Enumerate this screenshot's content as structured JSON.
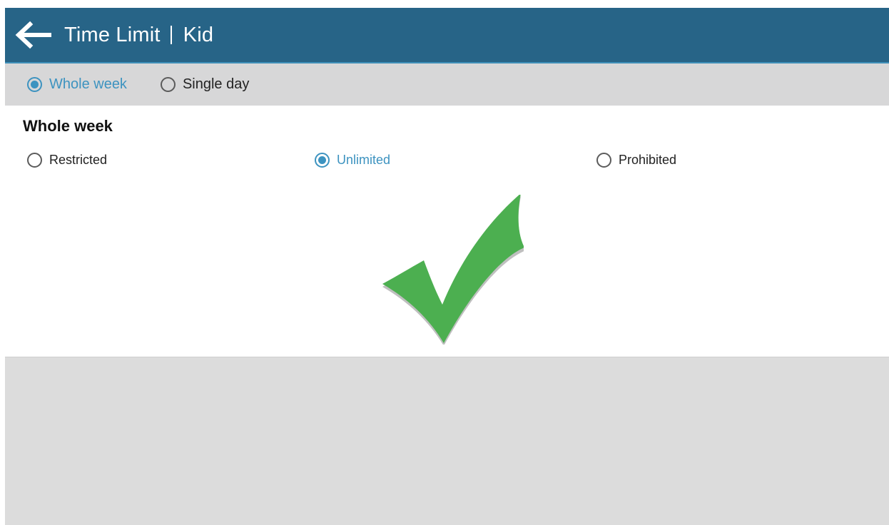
{
  "header": {
    "title": "Time Limit",
    "profile": "Kid",
    "back_icon": "arrow-left-icon"
  },
  "mode_tabs": [
    {
      "label": "Whole week",
      "checked": true
    },
    {
      "label": "Single day",
      "checked": false
    }
  ],
  "section": {
    "title": "Whole week",
    "options": [
      {
        "label": "Restricted",
        "checked": false
      },
      {
        "label": "Unlimited",
        "checked": true
      },
      {
        "label": "Prohibited",
        "checked": false
      }
    ],
    "status_icon": "checkmark-icon"
  },
  "colors": {
    "appbar": "#276487",
    "accent": "#3d93c0",
    "check_green": "#4caf50",
    "panel_gray": "#dcdcdc"
  }
}
